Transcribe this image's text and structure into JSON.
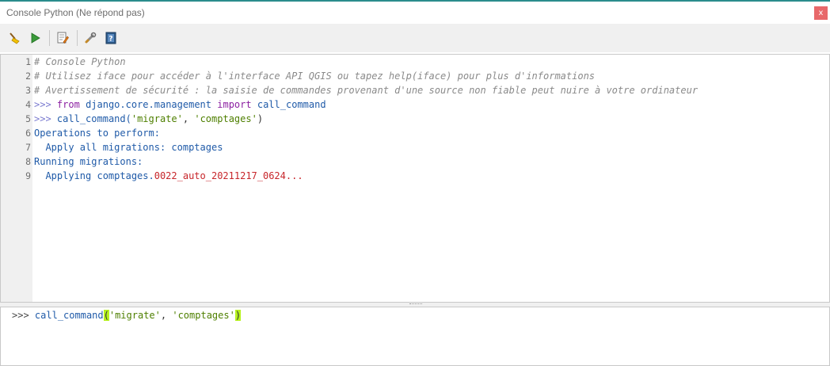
{
  "window": {
    "title": "Console Python (Ne répond pas)",
    "close_label": "x"
  },
  "toolbar": {
    "buttons": [
      {
        "name": "clear-console",
        "icon": "broom-icon"
      },
      {
        "name": "run-command",
        "icon": "play-icon"
      },
      {
        "name": "show-editor",
        "icon": "editor-icon"
      },
      {
        "name": "options",
        "icon": "wrench-icon"
      },
      {
        "name": "help",
        "icon": "help-book-icon"
      }
    ]
  },
  "console": {
    "line_numbers": [
      "1",
      "2",
      "3",
      "4",
      "5",
      "6",
      "7",
      "8",
      "9"
    ],
    "lines": {
      "l1": "# Console Python",
      "l2": "# Utilisez iface pour accéder à l'interface API QGIS ou tapez help(iface) pour plus d'informations",
      "l3": "# Avertissement de sécurité : la saisie de commandes provenant d'une source non fiable peut nuire à votre ordinateur",
      "l4_prompt": ">>>",
      "l4_from": "from",
      "l4_module": "django.core.management",
      "l4_import": "import",
      "l4_name": "call_command",
      "l5_prompt": ">>>",
      "l5_call": "call_command(",
      "l5_arg1": "'migrate'",
      "l5_comma": ",",
      "l5_arg2": "'comptages'",
      "l5_close": ")",
      "l6": "Operations to perform:",
      "l7": "  Apply all migrations: comptages",
      "l8": "Running migrations:",
      "l9_a": "  Applying comptages.",
      "l9_b": "0022_auto_20211217_0624..."
    }
  },
  "input": {
    "prompt": ">>>",
    "func": "call_command",
    "open_paren": "(",
    "arg1": "'migrate'",
    "comma": ",",
    "arg2": "'comptages'",
    "close_paren": ")"
  },
  "colors": {
    "accent": "#2a8c8c",
    "close_button": "#e8686a",
    "bracket_highlight": "#b6f21e",
    "comment": "#8a8a8a",
    "keyword": "#8b1fa1",
    "identifier": "#1f5aa8",
    "string": "#4e7f00",
    "number": "#c7252a"
  }
}
